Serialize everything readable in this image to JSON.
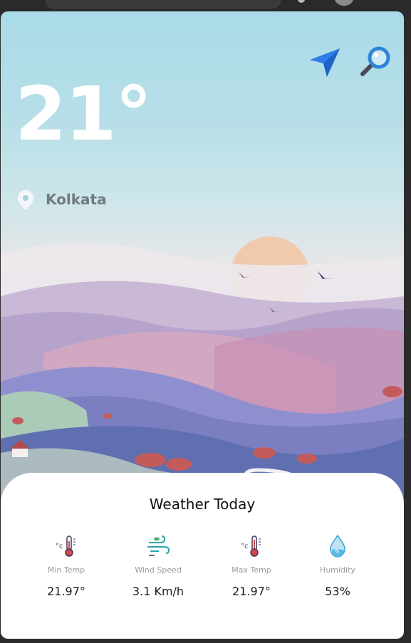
{
  "weather": {
    "temperature": "21°",
    "city": "Kolkata"
  },
  "today": {
    "title": "Weather Today",
    "stats": [
      {
        "label": "Min Temp",
        "value": "21.97°",
        "icon": "thermometer-icon"
      },
      {
        "label": "Wind Speed",
        "value": "3.1 Km/h",
        "icon": "wind-icon"
      },
      {
        "label": "Max Temp",
        "value": "21.97°",
        "icon": "thermometer-icon"
      },
      {
        "label": "Humidity",
        "value": "53%",
        "icon": "droplet-icon"
      }
    ]
  },
  "colors": {
    "accent_blue": "#2f7de8",
    "temp_text": "#ffffff",
    "city_text": "#707a80"
  }
}
